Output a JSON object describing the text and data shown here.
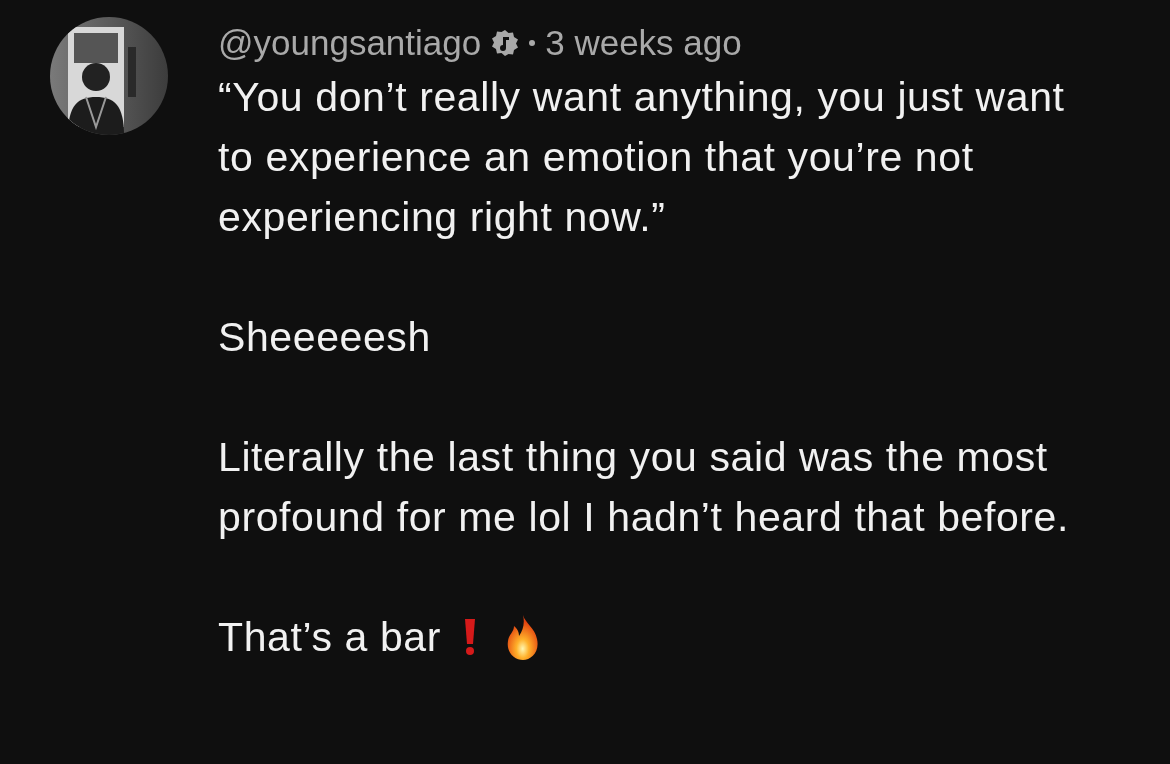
{
  "comment": {
    "author": "@youngsantiago",
    "verified": true,
    "time": "3 weeks ago",
    "paragraphs": [
      {
        "text": "“You don’t really want anything, you just want to experience an emotion that you’re not experiencing right now.”"
      },
      {
        "text": "Sheeeeesh"
      },
      {
        "text": "Literally the last thing you said was the most profound for me lol I hadn’t heard that before."
      },
      {
        "text": "That’s a bar",
        "kind": "with-emoji"
      }
    ]
  }
}
